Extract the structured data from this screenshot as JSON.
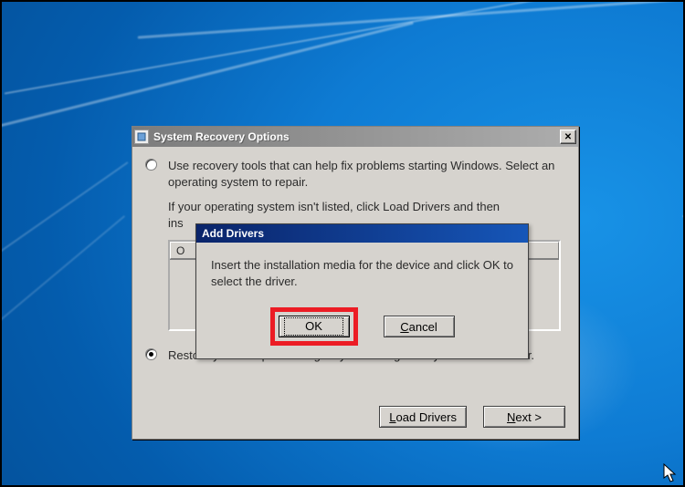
{
  "main_dialog": {
    "title": "System Recovery Options",
    "option1": "Use recovery tools that can help fix problems starting Windows. Select an operating system to repair.",
    "note_line1": "If your operating system isn't listed, click Load Drivers and then",
    "note_line2_prefix": "ins",
    "option2": "Restore your computer using a system image that you created earlier.",
    "list": {
      "col1": "O",
      "col2": ""
    },
    "buttons": {
      "load_drivers_text": "oad Drivers",
      "load_drivers_ul": "L",
      "next_text": "ext >",
      "next_ul": "N"
    }
  },
  "modal": {
    "title": "Add Drivers",
    "message": "Insert the installation media for the device and click OK to select the driver.",
    "ok": "OK",
    "cancel_text": "ancel",
    "cancel_ul": "C"
  }
}
